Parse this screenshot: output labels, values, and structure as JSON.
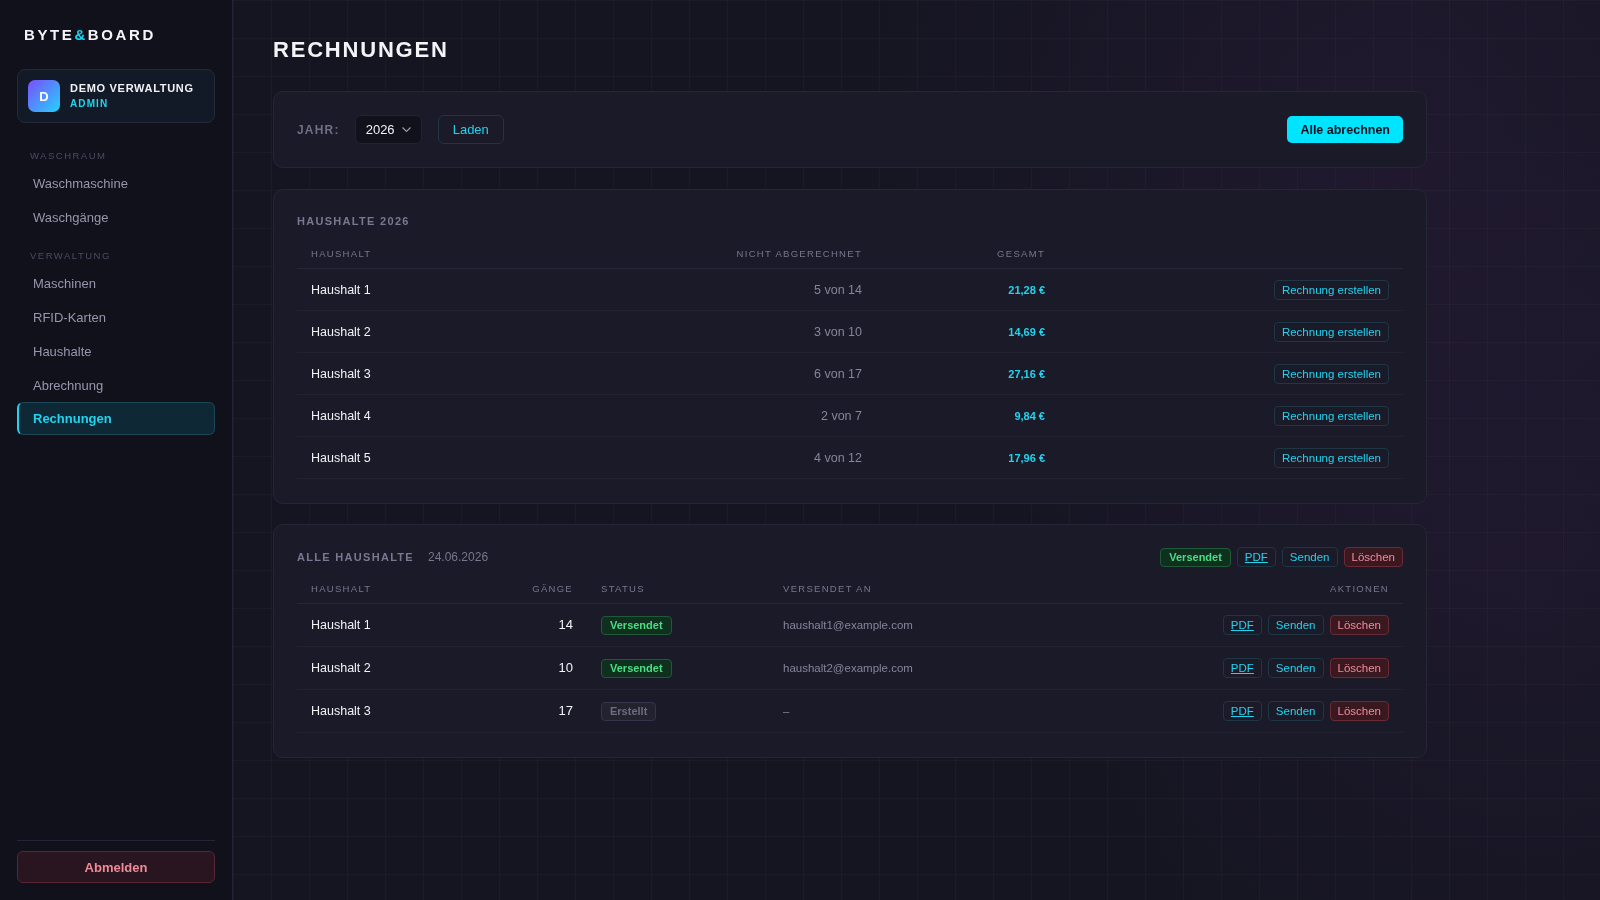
{
  "sidebar": {
    "logo": [
      {
        "text": "BYTE",
        "accent": false
      },
      {
        "text": "&",
        "accent": true
      },
      {
        "text": "BOARD",
        "accent": false
      }
    ],
    "user": {
      "avatar": "D",
      "name": "DEMO VERWALTUNG",
      "role": "ADMIN"
    },
    "sections": [
      {
        "title": "WASCHRAUM",
        "items": [
          {
            "label": "Waschmaschine",
            "selected": false
          },
          {
            "label": "Waschgänge",
            "selected": false
          }
        ]
      },
      {
        "title": "VERWALTUNG",
        "items": [
          {
            "label": "Maschinen",
            "selected": false
          },
          {
            "label": "RFID-Karten",
            "selected": false
          },
          {
            "label": "Haushalte",
            "selected": false
          },
          {
            "label": "Abrechnung",
            "selected": false
          },
          {
            "label": "Rechnungen",
            "selected": true
          }
        ]
      }
    ],
    "logout": "Abmelden"
  },
  "page_title": "RECHNUNGEN",
  "toolbar": {
    "year_label": "JAHR:",
    "year": "2026",
    "load_button": "Laden",
    "bill_all_button": "Alle abrechnen"
  },
  "households_card": {
    "title": "HAUSHALTE 2026",
    "columns": [
      "HAUSHALT",
      "NICHT ABGERECHNET",
      "GESAMT"
    ],
    "rows": [
      {
        "name": "Haushalt 1",
        "unbilled": "5 von 14",
        "total": "21,28 €",
        "action": "Rechnung erstellen"
      },
      {
        "name": "Haushalt 2",
        "unbilled": "3 von 10",
        "total": "14,69 €",
        "action": "Rechnung erstellen"
      },
      {
        "name": "Haushalt 3",
        "unbilled": "6 von 17",
        "total": "27,16 €",
        "action": "Rechnung erstellen"
      },
      {
        "name": "Haushalt 4",
        "unbilled": "2 von 7",
        "total": "9,84 €",
        "action": "Rechnung erstellen"
      },
      {
        "name": "Haushalt 5",
        "unbilled": "4 von 12",
        "total": "17,96 €",
        "action": "Rechnung erstellen"
      }
    ]
  },
  "invoices_card": {
    "title": "ALLE HAUSHALTE",
    "date": "24.06.2026",
    "status": {
      "label": "Versendet",
      "kind": "sent"
    },
    "actions": [
      {
        "label": "PDF",
        "kind": "pdf"
      },
      {
        "label": "Senden",
        "kind": "send"
      },
      {
        "label": "Löschen",
        "kind": "delete"
      }
    ],
    "columns": [
      "HAUSHALT",
      "GÄNGE",
      "STATUS",
      "VERSENDET AN",
      "AKTIONEN"
    ],
    "rows": [
      {
        "name": "Haushalt 1",
        "runs": "14",
        "status": {
          "label": "Versendet",
          "kind": "sent"
        },
        "recipient": "haushalt1@example.com",
        "actions": [
          {
            "label": "PDF",
            "kind": "pdf"
          },
          {
            "label": "Senden",
            "kind": "send"
          },
          {
            "label": "Löschen",
            "kind": "delete"
          }
        ]
      },
      {
        "name": "Haushalt 2",
        "runs": "10",
        "status": {
          "label": "Versendet",
          "kind": "sent"
        },
        "recipient": "haushalt2@example.com",
        "actions": [
          {
            "label": "PDF",
            "kind": "pdf"
          },
          {
            "label": "Senden",
            "kind": "send"
          },
          {
            "label": "Löschen",
            "kind": "delete"
          }
        ]
      },
      {
        "name": "Haushalt 3",
        "runs": "17",
        "status": {
          "label": "Erstellt",
          "kind": "created"
        },
        "recipient": "–",
        "actions": [
          {
            "label": "PDF",
            "kind": "pdf"
          },
          {
            "label": "Senden",
            "kind": "send"
          },
          {
            "label": "Löschen",
            "kind": "delete"
          }
        ]
      }
    ]
  }
}
